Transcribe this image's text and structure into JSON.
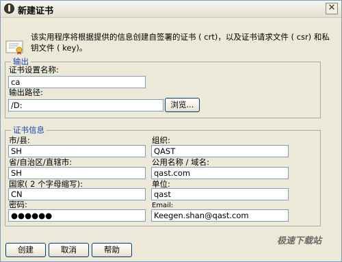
{
  "window": {
    "title": "新建证书",
    "close_label": "✕"
  },
  "intro_text": "该实用程序将根据提供的信息创建自签署的证书 ( crt)，以及证书请求文件 ( csr) 和私钥文件 ( key)。",
  "output": {
    "legend": "输出",
    "name_label": "证书设置名称:",
    "name_value": "ca",
    "path_label": "输出路径:",
    "path_value": "/D:",
    "browse_label": "浏览..."
  },
  "cert_info": {
    "legend": "证书信息",
    "city_label": "市/县:",
    "city_value": "SH",
    "org_label": "组织:",
    "org_value": "QAST",
    "province_label": "省/自治区/直辖市:",
    "province_value": "SH",
    "common_name_label": "公用名称 / 域名:",
    "common_name_value": "qast.com",
    "country_label": "国家( 2 个字母缩写):",
    "country_value": "CN",
    "unit_label": "单位:",
    "unit_value": "qast",
    "password_label": "密码:",
    "password_value": "●●●●●●",
    "email_label": "Email:",
    "email_value": "Keegen.shan@qast.com"
  },
  "buttons": {
    "create": "创建",
    "cancel": "取消",
    "help": "帮助"
  },
  "watermark": "极速下载站",
  "colors": {
    "legend": "#1a44b8",
    "window_bg": "#ece9d8",
    "field_border": "#7f9db9"
  }
}
